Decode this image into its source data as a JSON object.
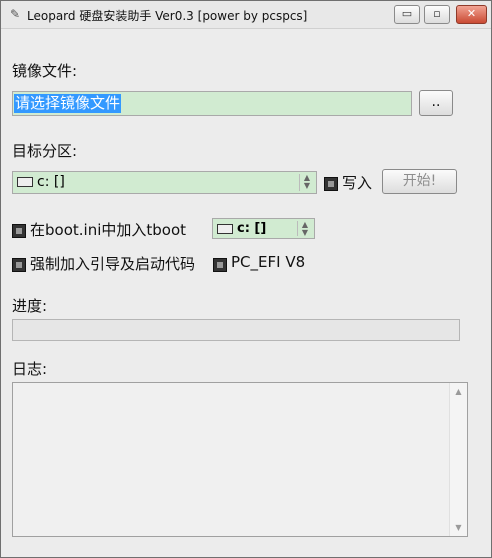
{
  "window": {
    "title": "Leopard 硬盘安装助手 Ver0.3 [power by pcspcs]",
    "controls": {
      "minimize": "▭",
      "maximize": "▫",
      "close": "✕"
    }
  },
  "image_file": {
    "label": "镜像文件:",
    "input_value": "请选择镜像文件",
    "browse_label": ".."
  },
  "target_partition": {
    "label": "目标分区:",
    "selected": "c: []",
    "write_checkbox_label": "写入",
    "start_button_label": "开始!"
  },
  "options": {
    "boot_ini_label": "在boot.ini中加入tboot",
    "boot_drive_selected": "c: []",
    "force_boot_code_label": "强制加入引导及启动代码",
    "pc_efi_label": "PC_EFI V8"
  },
  "progress": {
    "label": "进度:",
    "value": 0
  },
  "log": {
    "label": "日志:",
    "content": ""
  },
  "icons": {
    "app": "app-icon",
    "disk": "disk-drive-icon",
    "checkbox": "checkbox"
  },
  "colors": {
    "field_bg": "#d1ebd1",
    "selection": "#3399ff",
    "close_button": "#c94a33"
  }
}
